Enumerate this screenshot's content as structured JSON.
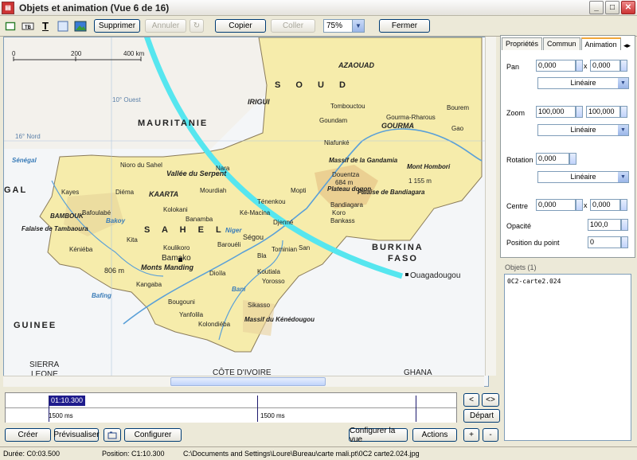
{
  "window": {
    "title": "Objets et animation  (Vue 6 de 16)",
    "app_icon": "app-icon",
    "minimize": "_",
    "maximize": "□",
    "close": "✕"
  },
  "toolbar": {
    "tool_icon_text_label": "T",
    "tool_icon_frame_label": "▭",
    "buttons": {
      "supprimer": "Supprimer",
      "annuler": "Annuler",
      "redo": "↻",
      "copier": "Copier",
      "coller": "Coller",
      "fermer": "Fermer"
    },
    "zoom": "75%"
  },
  "map": {
    "scale_labels": [
      "0",
      "200",
      "400 km"
    ],
    "longitude_labels": [
      "10° Ouest",
      "16° Nord"
    ],
    "regions": {
      "mauritanie": "MAURITANIE",
      "soudan": "S  O  U  D",
      "sahel": "S    A    H    E    L",
      "guinee": "GUINEE",
      "sierra": "SIERRA",
      "leone": "LEONE",
      "burkina1": "BURKINA",
      "burkina2": "FASO",
      "cote": "CÔTE D'IVOIRE",
      "ghana": "GHANA",
      "gal": "GAL"
    },
    "places": {
      "azaouad": "AZAOUAD",
      "irigui": "IRIGUI",
      "tombouctou": "Tombouctou",
      "gourma": "GOURMA",
      "goundam": "Goundam",
      "gourma_rharous": "Gourma-Rharous",
      "bourem": "Bourem",
      "gao": "Gao",
      "niafunke": "Niafunké",
      "nioro": "Nioro du Sahel",
      "diema": "Diéma",
      "kaarta": "KAARTA",
      "vallee_serpent": "Vallée du Serpent",
      "mourdiah": "Mourdiah",
      "nara": "Nara",
      "kayes": "Kayes",
      "bafoulabe": "Bafoulabé",
      "kolokani": "Kolokani",
      "banamba": "Banamba",
      "bambouk": "BAMBOUK",
      "falaise_tambaoura": "Falaise de Tambaoura",
      "kita": "Kita",
      "kenieba": "Kéniéba",
      "bamako": "Bamako",
      "monts_manding": "Monts Manding",
      "koulikoro": "Koulikoro",
      "segou": "Ségou",
      "baroueli": "Barouéli",
      "san": "San",
      "djenne": "Djenné",
      "mopti": "Mopti",
      "tenenkou": "Ténenkou",
      "ke_macina": "Ké-Macina",
      "massif_gandamia": "Massif de la Gandamia",
      "douentza": "Douentza",
      "mont_hombori": "Mont Hombori",
      "hombori_alt": "1 155 m",
      "plateau_dogon": "Plateau dogon",
      "falaise_bandiagara": "Falaise de Bandiagara",
      "bandiagara": "Bandiagara",
      "bankass": "Bankass",
      "koro": "Koro",
      "alt_684": "684 m",
      "tominian": "Tominian",
      "bla": "Bla",
      "dioila": "Dioïla",
      "koutiala": "Koutiala",
      "yorosso": "Yorosso",
      "bougouni": "Bougouni",
      "yanfolila": "Yanfolila",
      "kolondieba": "Kolondiéba",
      "sikasso": "Sikasso",
      "massif_kenedougou": "Massif du Kénédougou",
      "kangaba": "Kangaba",
      "alt_806": "806 m",
      "ouagadougou": "Ouagadougou",
      "niger": "Niger",
      "senegal": "Sénégal",
      "bani": "Bani",
      "bafing": "Bafing",
      "bakoy": "Bakoy"
    }
  },
  "panel": {
    "tabs": [
      "Propriétés",
      "Commun",
      "Animation"
    ],
    "active_tab": "Animation",
    "pan_label": "Pan",
    "pan_x": "0,000",
    "pan_y": "0,000",
    "times": "x",
    "pan_mode": "Linéaire",
    "zoom_label": "Zoom",
    "zoom_x": "100,000",
    "zoom_y": "100,000",
    "zoom_mode": "Linéaire",
    "rotation_label": "Rotation",
    "rotation": "0,000",
    "rotation_mode": "Linéaire",
    "centre_label": "Centre",
    "centre_x": "0,000",
    "centre_y": "0,000",
    "opacite_label": "Opacité",
    "opacite": "100,0",
    "position_label": "Position du point",
    "position": "0",
    "objects_label": "Objets (1)",
    "objects": [
      "0C2-carte2.024"
    ]
  },
  "timeline": {
    "time_tag": "01:10.300",
    "label1": "1500 ms",
    "label2": "1500 ms",
    "nav_prev": "<",
    "nav_next": "<>",
    "depart": "Départ"
  },
  "bottom": {
    "creer": "Créer",
    "previsualiser": "Prévisualiser",
    "configurer": "Configurer",
    "configurer_vue": "Configurer la vue",
    "actions": "Actions",
    "plus": "+",
    "minus": "-"
  },
  "status": {
    "duree": "Durée: C0:03.500",
    "position": "Position:  C1:10.300",
    "path": "C:\\Documents and Settings\\Loure\\Bureau\\carte mali.pt\\0C2 carte2.024.jpg"
  }
}
